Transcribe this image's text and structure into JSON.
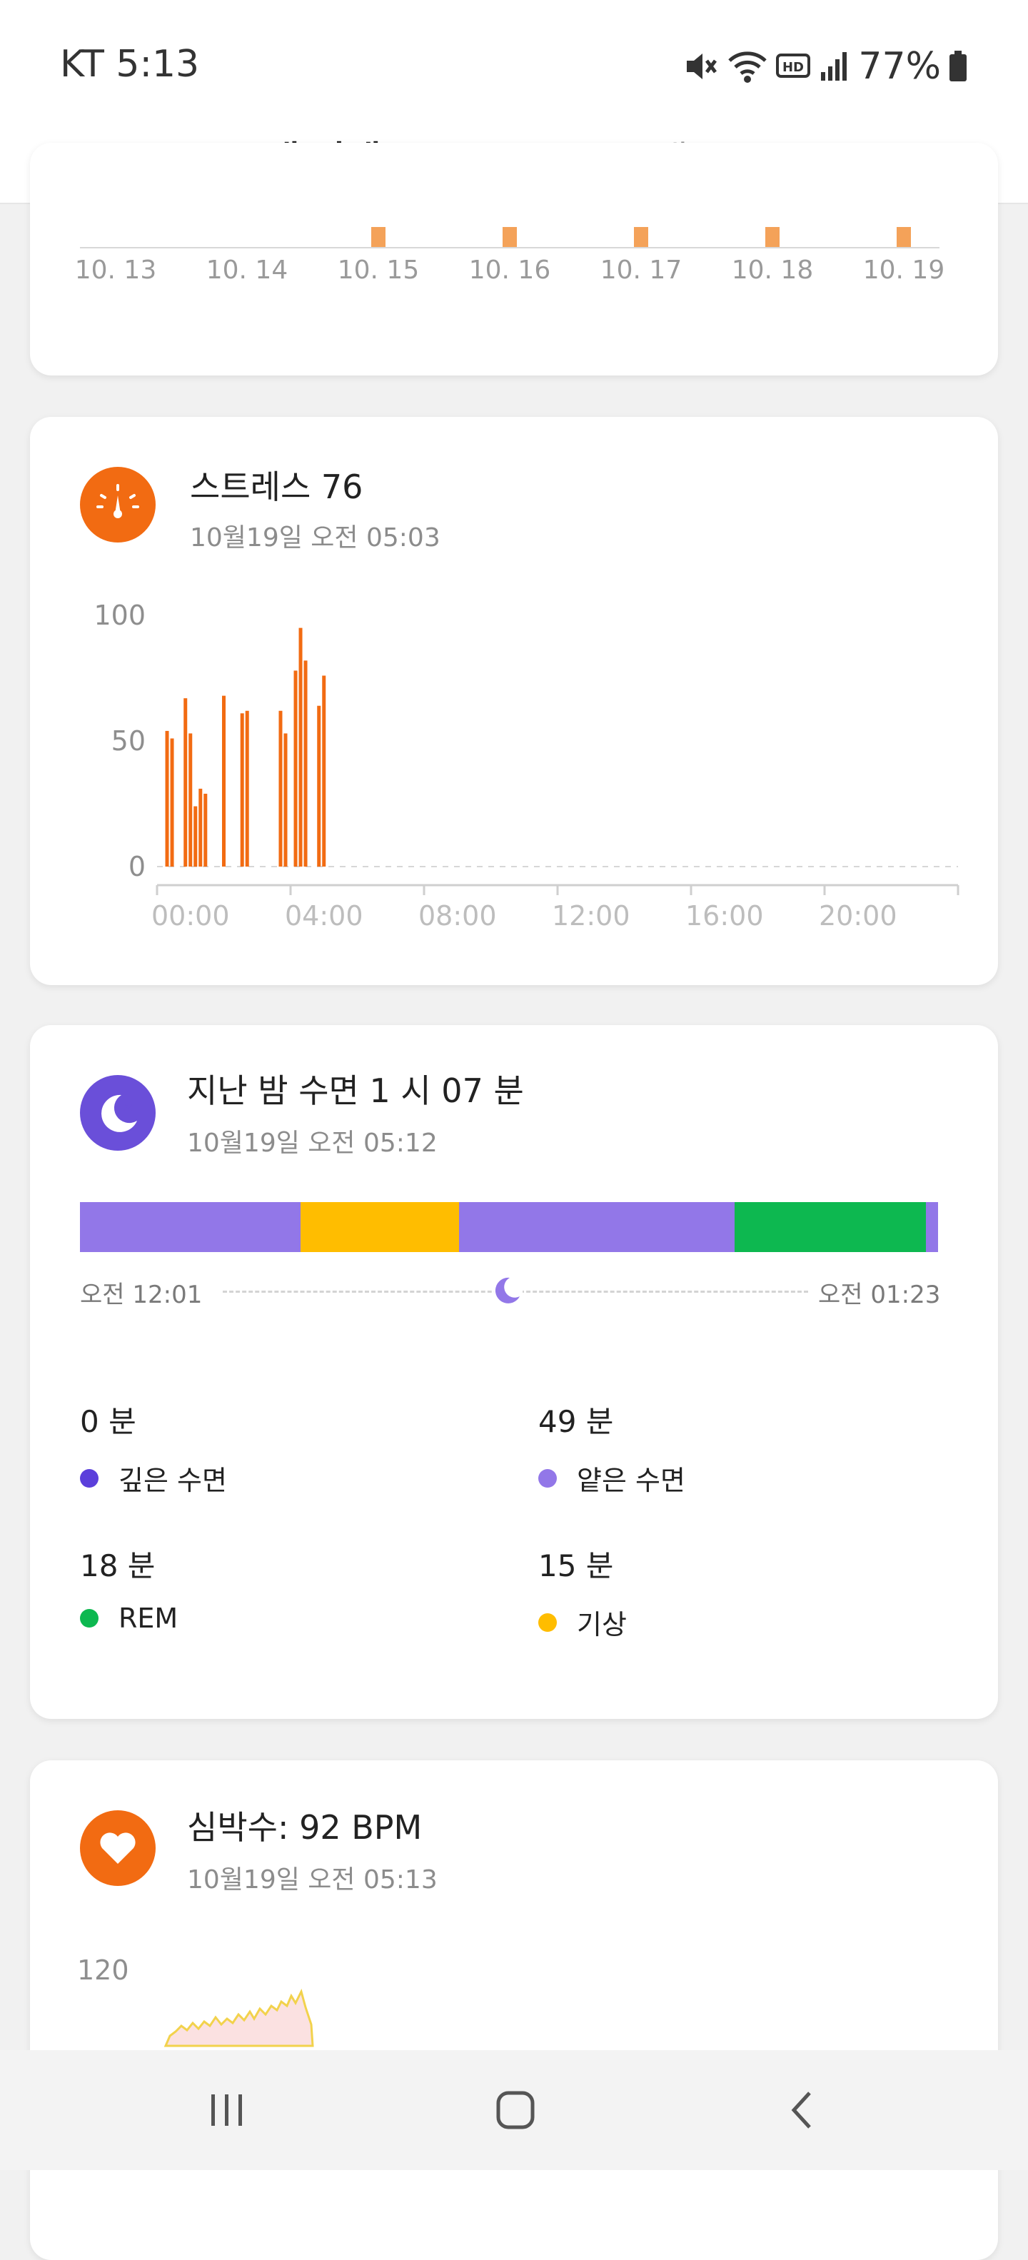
{
  "status_bar": {
    "carrier_time": "KT 5:13",
    "battery": "77%"
  },
  "header": {
    "tabs": [
      {
        "label": "내 상태",
        "active": true
      },
      {
        "label": "내 운동",
        "active": false
      }
    ]
  },
  "top_card": {
    "dates": [
      "10. 13",
      "10. 14",
      "10. 15",
      "10. 16",
      "10. 17",
      "10. 18",
      "10. 19"
    ],
    "bar_flags": [
      0,
      0,
      1,
      1,
      1,
      1,
      1
    ],
    "bar_color": "#f4a259"
  },
  "stress": {
    "title": "스트레스 76",
    "timestamp": "10월19일 오전 05:03",
    "icon": "gauge-icon",
    "accent": "#f26b12",
    "chart_data": {
      "type": "bar",
      "title": "",
      "x_unit": "hour",
      "xlim": [
        0,
        24
      ],
      "ylim": [
        0,
        100
      ],
      "yticks": [
        "100",
        "50",
        "0"
      ],
      "xticks": [
        "00:00",
        "04:00",
        "08:00",
        "12:00",
        "16:00",
        "20:00"
      ],
      "bars": [
        {
          "x": 0.3,
          "y": 54
        },
        {
          "x": 0.45,
          "y": 51
        },
        {
          "x": 0.85,
          "y": 67
        },
        {
          "x": 1.0,
          "y": 53
        },
        {
          "x": 1.15,
          "y": 24
        },
        {
          "x": 1.3,
          "y": 31
        },
        {
          "x": 1.45,
          "y": 29
        },
        {
          "x": 2.0,
          "y": 68
        },
        {
          "x": 2.55,
          "y": 61
        },
        {
          "x": 2.7,
          "y": 62
        },
        {
          "x": 3.7,
          "y": 62
        },
        {
          "x": 3.85,
          "y": 53
        },
        {
          "x": 4.15,
          "y": 78
        },
        {
          "x": 4.3,
          "y": 95
        },
        {
          "x": 4.45,
          "y": 82
        },
        {
          "x": 4.85,
          "y": 64
        },
        {
          "x": 5.0,
          "y": 76
        }
      ]
    }
  },
  "sleep": {
    "title": "지난 밤 수면 1 시 07 분",
    "timestamp": "10월19일 오전 05:12",
    "icon": "moon-zz-icon",
    "accent": "#6a4fd9",
    "start_label": "오전 12:01",
    "end_label": "오전 01:23",
    "timeline": [
      {
        "stage": "light",
        "fraction": 0.257,
        "color": "#9277e8"
      },
      {
        "stage": "awake",
        "fraction": 0.185,
        "color": "#ffbd00"
      },
      {
        "stage": "light",
        "fraction": 0.321,
        "color": "#9277e8"
      },
      {
        "stage": "rem",
        "fraction": 0.223,
        "color": "#0db850"
      },
      {
        "stage": "light",
        "fraction": 0.014,
        "color": "#9277e8"
      }
    ],
    "stats": [
      {
        "value": "0 분",
        "label": "깊은 수면",
        "color": "#5b3fdb"
      },
      {
        "value": "49 분",
        "label": "얕은 수면",
        "color": "#9277e8"
      },
      {
        "value": "18 분",
        "label": "REM",
        "color": "#0db850"
      },
      {
        "value": "15 분",
        "label": "기상",
        "color": "#ffbd00"
      }
    ]
  },
  "heart": {
    "title": "심박수: 92 BPM",
    "timestamp": "10월19일 오전 05:13",
    "icon": "heart-icon",
    "accent": "#f26b12",
    "y_label": "120"
  }
}
